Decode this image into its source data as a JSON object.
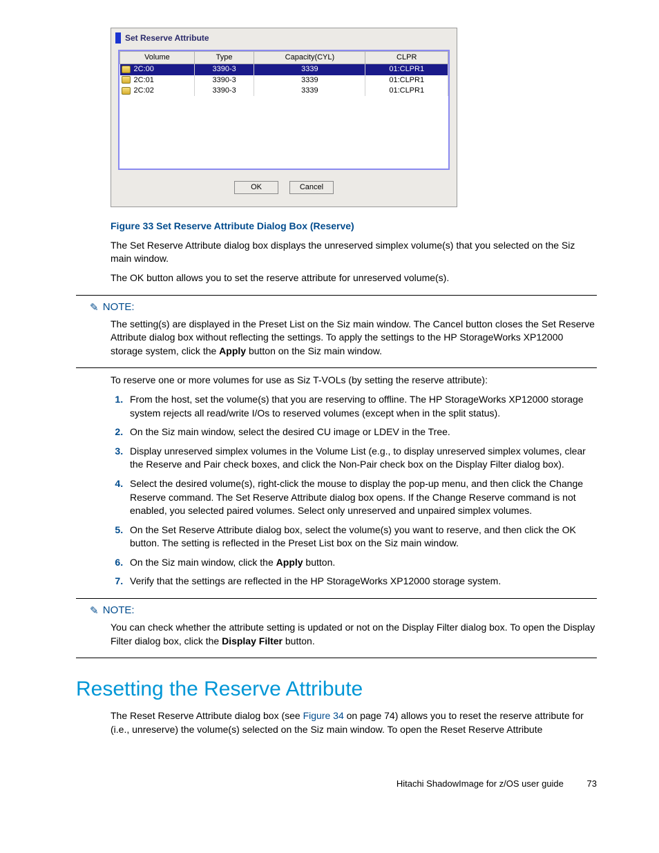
{
  "dialog": {
    "title": "Set Reserve Attribute",
    "columns": [
      "Volume",
      "Type",
      "Capacity(CYL)",
      "CLPR"
    ],
    "rows": [
      {
        "volume": "2C:00",
        "type": "3390-3",
        "capacity": "3339",
        "clpr": "01:CLPR1",
        "selected": true
      },
      {
        "volume": "2C:01",
        "type": "3390-3",
        "capacity": "3339",
        "clpr": "01:CLPR1",
        "selected": false
      },
      {
        "volume": "2C:02",
        "type": "3390-3",
        "capacity": "3339",
        "clpr": "01:CLPR1",
        "selected": false
      }
    ],
    "ok": "OK",
    "cancel": "Cancel"
  },
  "figure_caption": "Figure 33 Set Reserve Attribute Dialog Box (Reserve)",
  "para1": "The Set Reserve Attribute dialog box displays the unreserved simplex volume(s) that you selected on the Siz main window.",
  "para2": "The OK button allows you to set the reserve attribute for unreserved volume(s).",
  "note1": {
    "label": "NOTE:",
    "t1": "The setting(s) are displayed in the Preset List on the Siz main window. The Cancel button closes the Set Reserve Attribute dialog box without reflecting the settings. To apply the settings to the HP StorageWorks XP12000 storage system, click the ",
    "apply": "Apply",
    "t2": " button on the Siz main window."
  },
  "para3": "To reserve one or more volumes for use as Siz T-VOLs (by setting the reserve attribute):",
  "steps": {
    "s1": "From the host, set the volume(s) that you are reserving to offline. The HP StorageWorks XP12000 storage system rejects all read/write I/Os to reserved volumes (except when in the split status).",
    "s2": "On the Siz main window, select the desired CU image or LDEV in the Tree.",
    "s3": "Display unreserved simplex volumes in the Volume List (e.g., to display unreserved simplex volumes, clear the Reserve and Pair check boxes, and click the Non-Pair check box on the Display Filter dialog box).",
    "s4": "Select the desired volume(s), right-click the mouse to display the pop-up menu, and then click the Change Reserve command. The Set Reserve Attribute dialog box opens. If the Change Reserve command is not enabled, you selected paired volumes. Select only unreserved and unpaired simplex volumes.",
    "s5": "On the Set Reserve Attribute dialog box, select the volume(s) you want to reserve, and then click the OK button. The setting is reflected in the Preset List box on the Siz main window.",
    "s6a": "On the Siz main window, click the ",
    "s6btn": "Apply",
    "s6b": " button.",
    "s7": "Verify that the settings are reflected in the HP StorageWorks XP12000 storage system."
  },
  "note2": {
    "label": "NOTE:",
    "t1": "You can check whether the attribute setting is updated or not on the Display Filter dialog box. To open the Display Filter dialog box, click the ",
    "btn": "Display Filter",
    "t2": " button."
  },
  "section_heading": "Resetting the Reserve Attribute",
  "section_para_a": "The Reset Reserve Attribute dialog box (see ",
  "section_link": "Figure 34",
  "section_para_b": " on page 74) allows you to reset the reserve attribute for (i.e., unreserve) the volume(s) selected on the Siz main window. To open the Reset Reserve Attribute",
  "footer": {
    "text": "Hitachi ShadowImage for z/OS user guide",
    "page": "73"
  }
}
